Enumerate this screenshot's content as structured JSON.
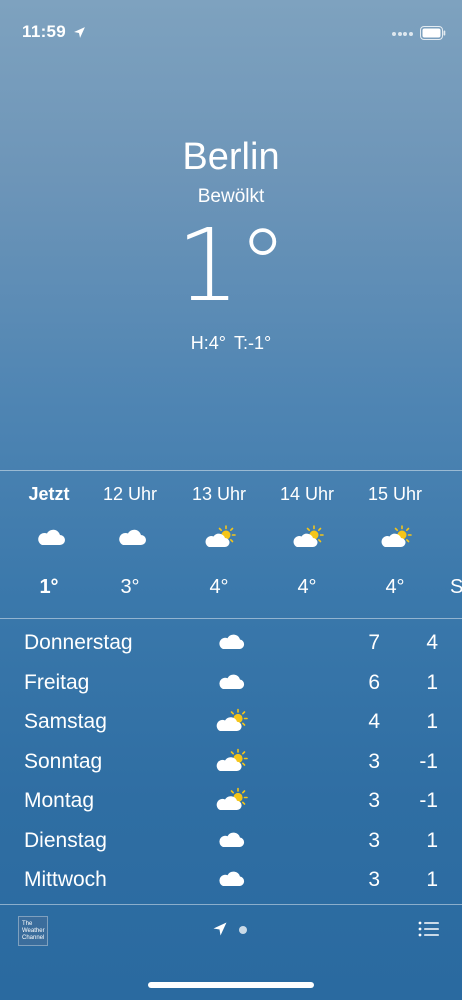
{
  "status_bar": {
    "time": "11:59",
    "location_icon": "location-arrow-icon",
    "signal_icon": "signal-dots-icon",
    "battery_icon": "battery-icon"
  },
  "location": {
    "city": "Berlin",
    "condition": "Bewölkt",
    "temperature": "1°",
    "high": "H:4°",
    "low": "T:-1°"
  },
  "hourly": [
    {
      "label": "Jetzt",
      "icon": "cloud-icon",
      "temp": "1°"
    },
    {
      "label": "12 Uhr",
      "icon": "cloud-icon",
      "temp": "3°"
    },
    {
      "label": "13 Uhr",
      "icon": "partly-cloudy-icon",
      "temp": "4°"
    },
    {
      "label": "14 Uhr",
      "icon": "partly-cloudy-icon",
      "temp": "4°"
    },
    {
      "label": "15 Uhr",
      "icon": "partly-cloudy-icon",
      "temp": "4°"
    },
    {
      "label": "",
      "icon": "",
      "temp": "S"
    }
  ],
  "daily": [
    {
      "day": "Donnerstag",
      "icon": "cloud-icon",
      "high": "7",
      "low": "4"
    },
    {
      "day": "Freitag",
      "icon": "cloud-icon",
      "high": "6",
      "low": "1"
    },
    {
      "day": "Samstag",
      "icon": "partly-cloudy-icon",
      "high": "4",
      "low": "1"
    },
    {
      "day": "Sonntag",
      "icon": "partly-cloudy-icon",
      "high": "3",
      "low": "-1"
    },
    {
      "day": "Montag",
      "icon": "partly-cloudy-icon",
      "high": "3",
      "low": "-1"
    },
    {
      "day": "Dienstag",
      "icon": "cloud-icon",
      "high": "3",
      "low": "1"
    },
    {
      "day": "Mittwoch",
      "icon": "cloud-icon",
      "high": "3",
      "low": "1"
    }
  ],
  "footer": {
    "logo_text": "The Weather Channel",
    "page_indicator": {
      "current": 1,
      "total": 2
    },
    "list_icon": "list-icon"
  },
  "colors": {
    "background_top": "#7ea2bf",
    "background_bottom": "#2a6aa0",
    "sun": "#f5c518",
    "text": "#ffffff"
  }
}
